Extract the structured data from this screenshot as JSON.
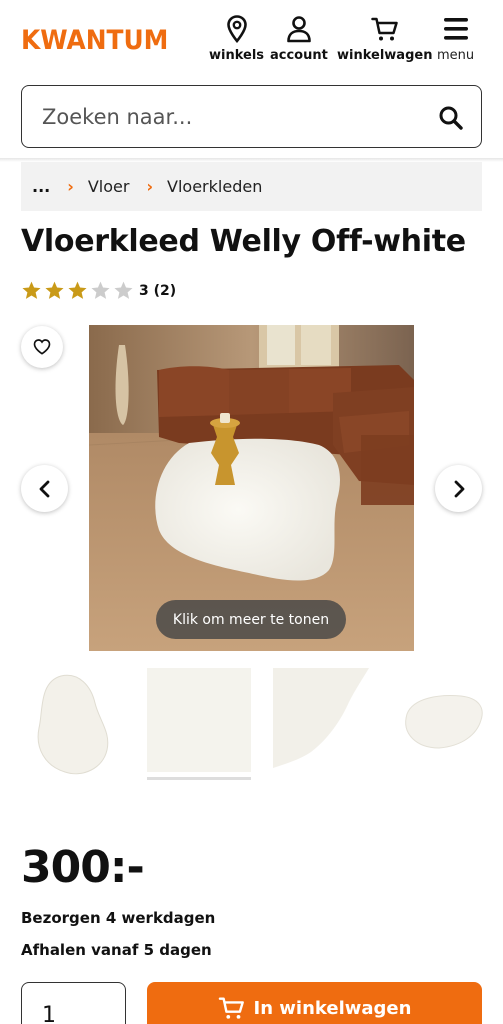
{
  "header": {
    "logo": "KWANTUM",
    "nav": [
      {
        "label": "winkels",
        "icon": "location-pin-icon"
      },
      {
        "label": "account",
        "icon": "user-icon"
      },
      {
        "label": "winkelwagen",
        "icon": "shopping-cart-icon"
      },
      {
        "label": "menu",
        "icon": "hamburger-menu-icon"
      }
    ]
  },
  "search": {
    "placeholder": "Zoeken naar...",
    "value": "",
    "icon": "search-icon"
  },
  "breadcrumb": {
    "ellipsis": "...",
    "items": [
      "Vloer",
      "Vloerkleden"
    ]
  },
  "product": {
    "title": "Vloerkleed Welly Off-white",
    "rating": {
      "score": 3,
      "max": 5,
      "text": "3 (2)"
    },
    "gallery": {
      "more_label": "Klik om meer te tonen",
      "thumbnail_count": 4,
      "active_thumbnail": 2
    },
    "price": "300:-",
    "delivery": "Bezorgen 4 werkdagen",
    "pickup": "Afhalen vanaf 5 dagen",
    "quantity": "1",
    "add_to_cart_label": "In winkelwagen"
  },
  "colors": {
    "brand": "#ef6c10",
    "star_filled": "#c99a18",
    "star_empty": "#cccccc",
    "text": "#111111"
  }
}
